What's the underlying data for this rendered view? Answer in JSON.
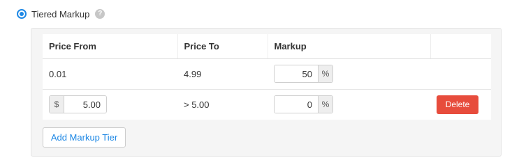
{
  "option": {
    "label": "Tiered Markup",
    "selected": true,
    "help_glyph": "?"
  },
  "table": {
    "headers": {
      "price_from": "Price From",
      "price_to": "Price To",
      "markup": "Markup",
      "actions": ""
    },
    "rows": [
      {
        "price_from": "0.01",
        "price_to": "4.99",
        "markup_value": "50",
        "markup_suffix": "%"
      },
      {
        "price_from_prefix": "$",
        "price_from_value": "5.00",
        "price_to": "> 5.00",
        "markup_value": "0",
        "markup_suffix": "%",
        "delete_label": "Delete"
      }
    ]
  },
  "add_tier_label": "Add Markup Tier",
  "colors": {
    "accent": "#1e88e5",
    "danger": "#e74c3c",
    "panel_bg": "#f5f5f5"
  },
  "icons": {
    "radio": "radio-selected-icon",
    "help": "help-question-icon"
  }
}
